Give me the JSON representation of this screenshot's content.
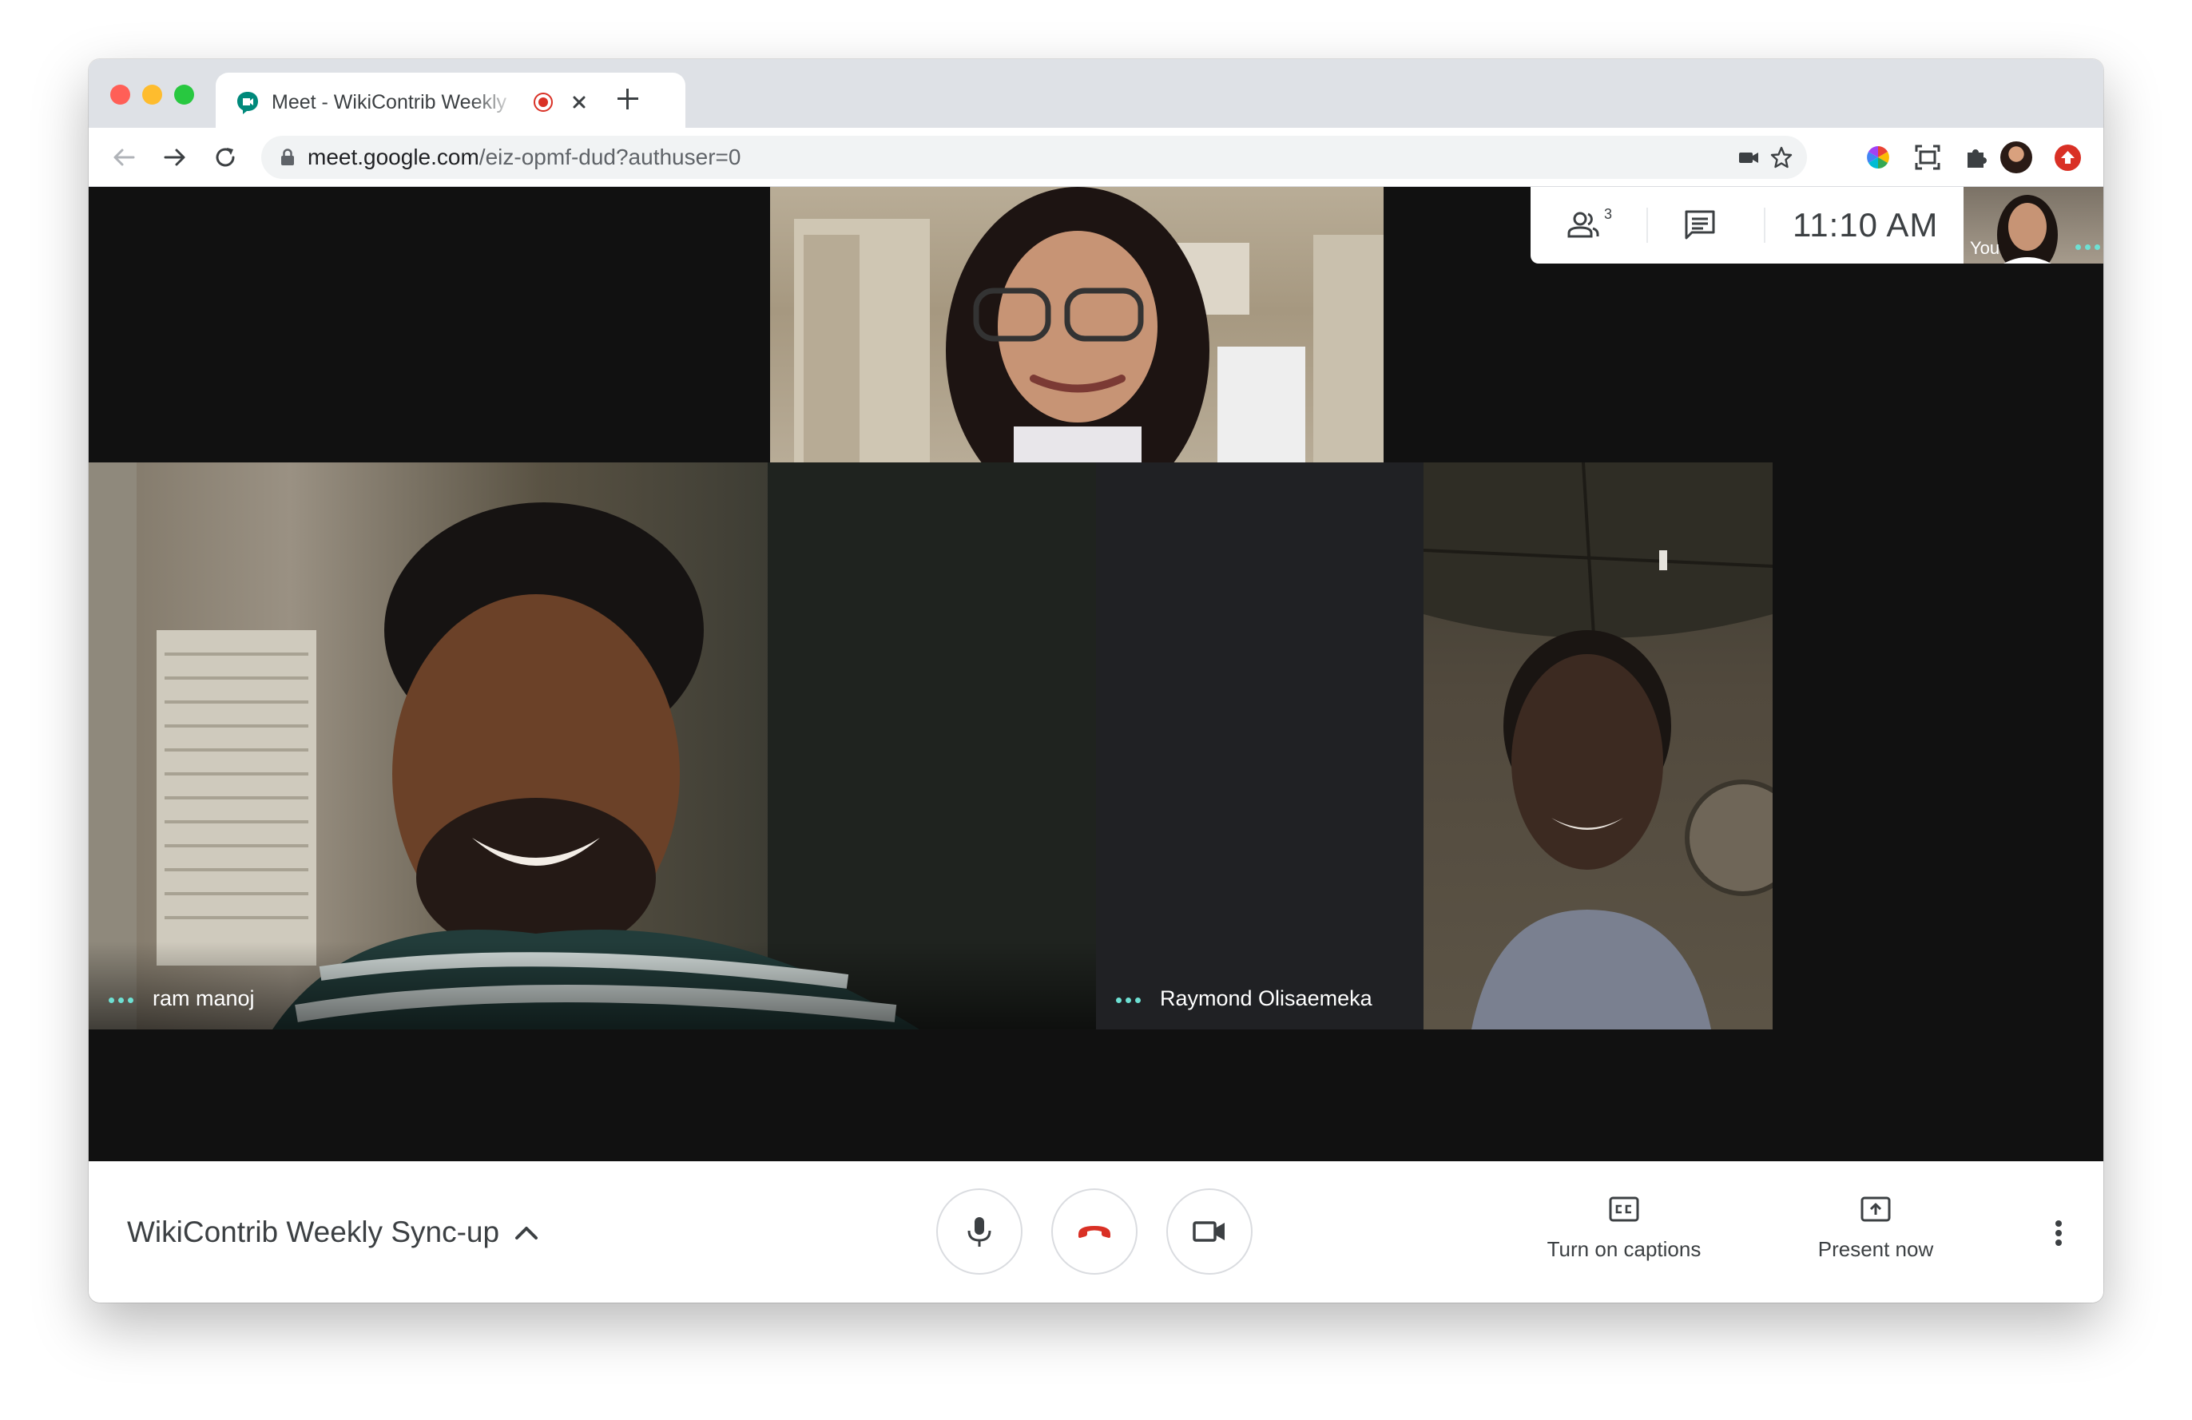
{
  "browser": {
    "tab_title": "Meet - WikiContrib Weekly",
    "url_host": "meet.google.com",
    "url_path": "/eiz-opmf-dud?authuser=0"
  },
  "meet": {
    "participants_count": "3",
    "time": "11:10  AM",
    "self_label": "You",
    "tiles": [
      {
        "name": "ram manoj"
      },
      {
        "name": "Raymond Olisaemeka"
      }
    ],
    "meeting_title": "WikiContrib Weekly Sync-up",
    "captions_label": "Turn on captions",
    "present_label": "Present now"
  },
  "colors": {
    "accent_teal": "#6ee0d3",
    "hangup_red": "#d93025",
    "meet_green": "#00897b",
    "stage_bg": "#111111"
  },
  "icons": [
    "meet-favicon-icon",
    "recording-icon",
    "close-icon",
    "plus-icon",
    "back-icon",
    "forward-icon",
    "reload-icon",
    "lock-icon",
    "camera-icon",
    "star-icon",
    "color-wheel-icon",
    "screenshot-icon",
    "extensions-icon",
    "profile-avatar",
    "update-icon",
    "people-icon",
    "chat-icon",
    "more-dots-icon",
    "chevron-up-icon",
    "mic-icon",
    "hangup-icon",
    "video-icon",
    "captions-icon",
    "present-icon",
    "more-vert-icon"
  ]
}
